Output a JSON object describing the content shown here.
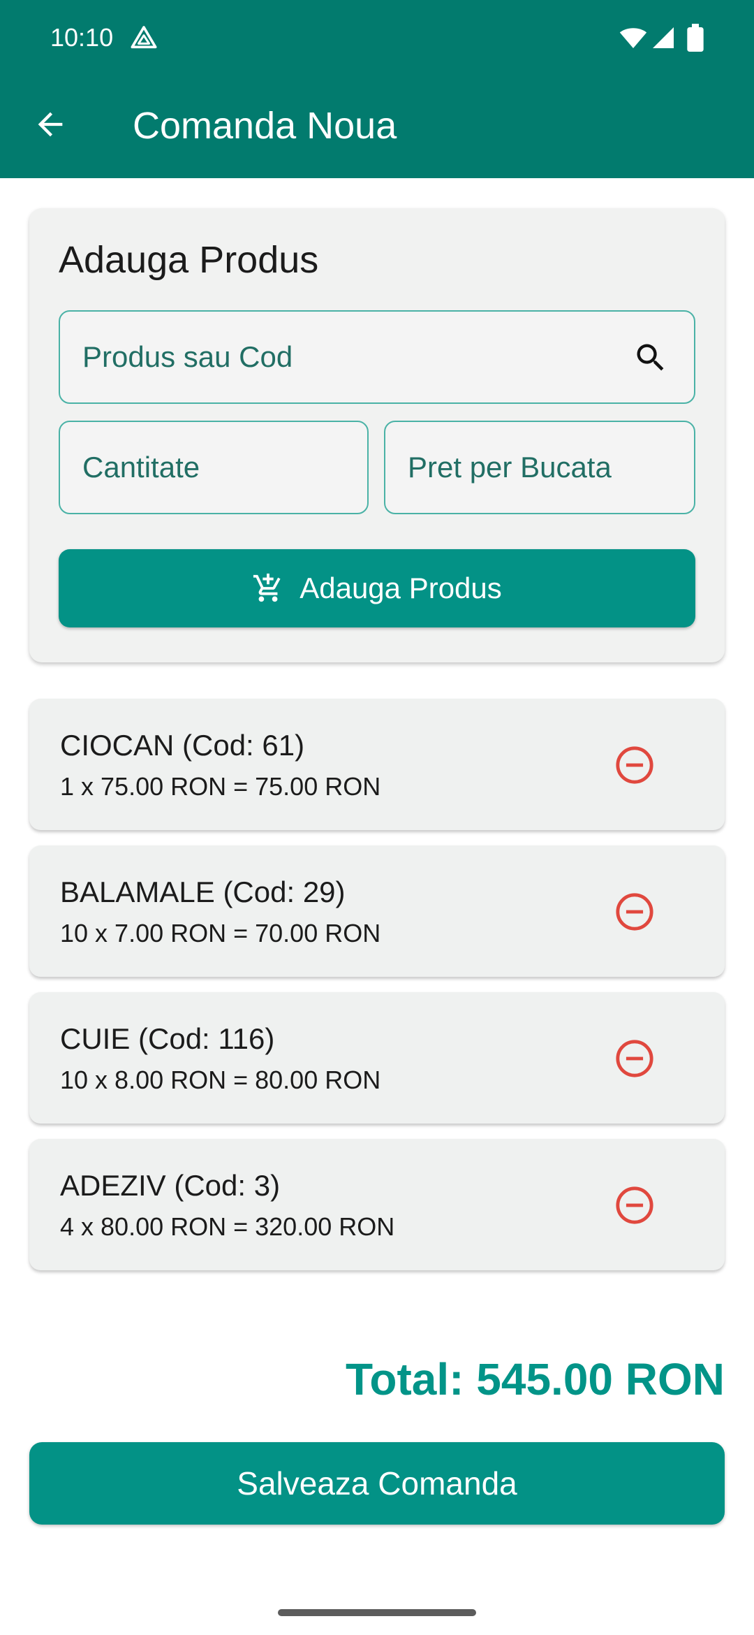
{
  "status_bar": {
    "time": "10:10",
    "icons": [
      "app-notification-icon",
      "wifi-icon",
      "signal-icon",
      "battery-icon"
    ]
  },
  "app_bar": {
    "title": "Comanda Noua",
    "back_icon": "arrow-back-icon",
    "color": "#027b6e"
  },
  "add_product": {
    "title": "Adauga Produs",
    "product_field": {
      "placeholder": "Produs sau Cod",
      "value": "",
      "icon": "search-icon"
    },
    "quantity_field": {
      "placeholder": "Cantitate",
      "value": ""
    },
    "price_field": {
      "placeholder": "Pret per Bucata",
      "value": ""
    },
    "add_button": {
      "label": "Adauga Produs",
      "icon": "add-cart-icon"
    }
  },
  "items": [
    {
      "name": "CIOCAN (Cod: 61)",
      "calc": "1 x 75.00 RON = 75.00 RON",
      "remove_icon": "remove-circle-icon"
    },
    {
      "name": "BALAMALE (Cod: 29)",
      "calc": "10 x 7.00 RON = 70.00 RON",
      "remove_icon": "remove-circle-icon"
    },
    {
      "name": "CUIE (Cod: 116)",
      "calc": "10 x 8.00 RON = 80.00 RON",
      "remove_icon": "remove-circle-icon"
    },
    {
      "name": "ADEZIV (Cod: 3)",
      "calc": "4 x 80.00 RON = 320.00 RON",
      "remove_icon": "remove-circle-icon"
    }
  ],
  "total": "Total: 545.00 RON",
  "save_button": {
    "label": "Salveaza Comanda"
  },
  "colors": {
    "primary": "#039286",
    "accent_text": "#029488",
    "remove_red": "#e0483e",
    "field_border": "#4ab2a6"
  }
}
